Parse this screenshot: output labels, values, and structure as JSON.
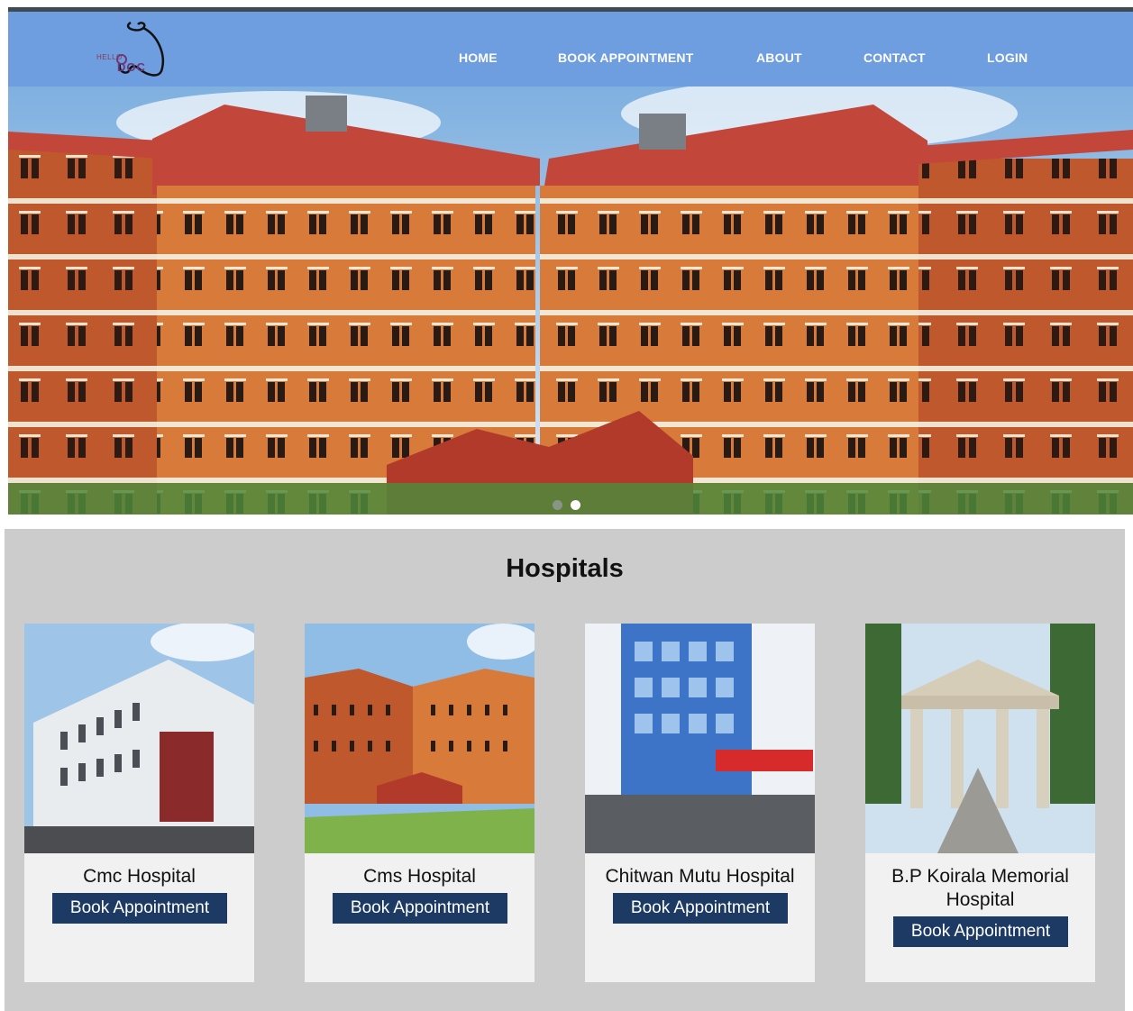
{
  "header": {
    "logo_small": "HELLO",
    "logo_big": "DOC",
    "nav": [
      {
        "label": "HOME"
      },
      {
        "label": "BOOK APPOINTMENT"
      },
      {
        "label": "ABOUT"
      },
      {
        "label": "CONTACT"
      },
      {
        "label": "LOGIN"
      }
    ]
  },
  "carousel": {
    "slide_count": 2,
    "active_index": 1
  },
  "hospitals": {
    "title": "Hospitals",
    "button_label": "Book Appointment",
    "items": [
      {
        "name": "Cmc Hospital"
      },
      {
        "name": "Cms Hospital"
      },
      {
        "name": "Chitwan Mutu Hospital"
      },
      {
        "name": "B.P Koirala Memorial Hospital"
      }
    ]
  },
  "colors": {
    "header_bg": "#6e9de0",
    "button_bg": "#1c3a64",
    "section_bg": "#cccccc",
    "card_bg": "#f1f1f1"
  }
}
